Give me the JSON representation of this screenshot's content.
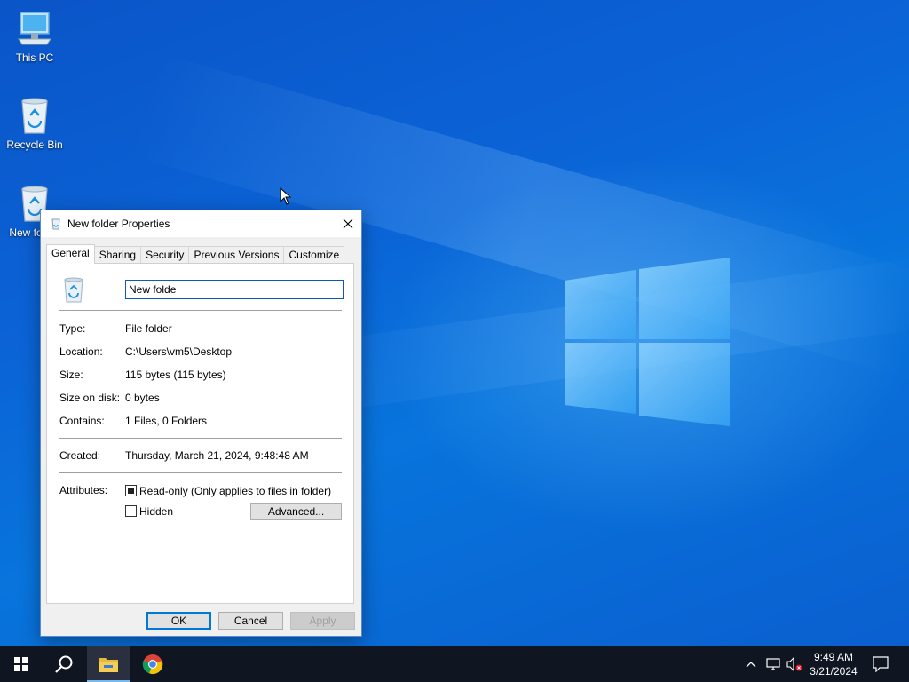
{
  "desktop": {
    "icons": [
      {
        "label": "This PC",
        "icon": "computer-icon"
      },
      {
        "label": "Recycle Bin",
        "icon": "recycle-bin-icon"
      },
      {
        "label": "New folder",
        "icon": "recycle-bin-icon"
      }
    ]
  },
  "dialog": {
    "title": "New folder Properties",
    "tabs": [
      "General",
      "Sharing",
      "Security",
      "Previous Versions",
      "Customize"
    ],
    "active_tab": "General",
    "name_value": "New folde",
    "fields": {
      "type_label": "Type:",
      "type_value": "File folder",
      "location_label": "Location:",
      "location_value": "C:\\Users\\vm5\\Desktop",
      "size_label": "Size:",
      "size_value": "115 bytes (115 bytes)",
      "size_on_disk_label": "Size on disk:",
      "size_on_disk_value": "0 bytes",
      "contains_label": "Contains:",
      "contains_value": "1 Files, 0 Folders",
      "created_label": "Created:",
      "created_value": "Thursday, March 21, 2024, 9:48:48 AM",
      "attributes_label": "Attributes:"
    },
    "attributes": {
      "readonly_label": "Read-only (Only applies to files in folder)",
      "readonly_state": "indeterminate",
      "hidden_label": "Hidden",
      "hidden_checked": false,
      "advanced_label": "Advanced..."
    },
    "buttons": {
      "ok": "OK",
      "cancel": "Cancel",
      "apply": "Apply"
    }
  },
  "taskbar": {
    "time": "9:49 AM",
    "date": "3/21/2024",
    "apps": [
      "start-icon",
      "search-icon",
      "file-explorer-icon",
      "chrome-icon"
    ]
  },
  "colors": {
    "accent": "#0078d7",
    "desktop_blue": "#0b63d6",
    "taskbar": "#101522"
  }
}
